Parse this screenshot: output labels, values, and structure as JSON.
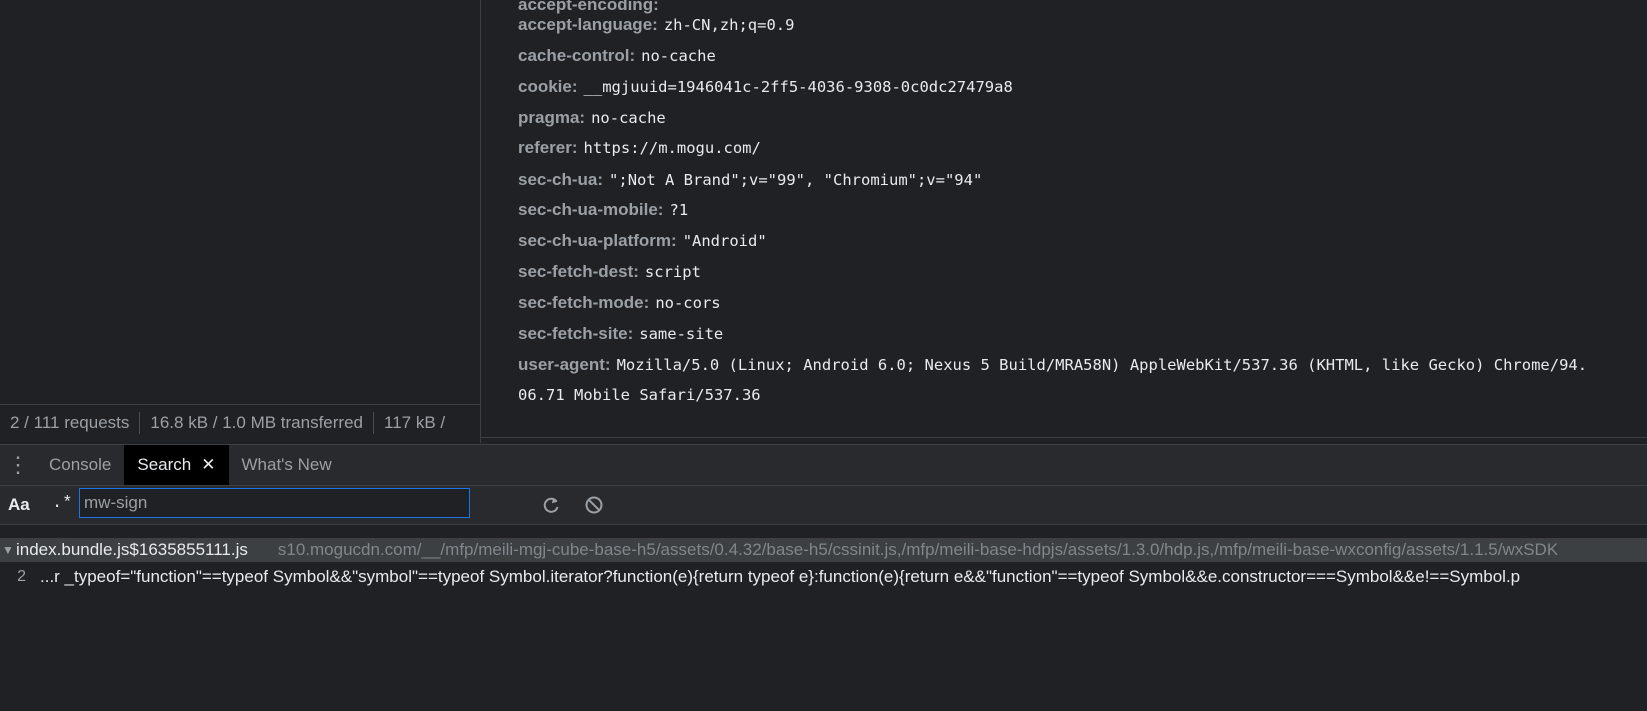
{
  "headers": {
    "rows": [
      {
        "name": "accept-language:",
        "value": "zh-CN,zh;q=0.9"
      },
      {
        "name": "cache-control:",
        "value": "no-cache"
      },
      {
        "name": "cookie:",
        "value": "__mgjuuid=1946041c-2ff5-4036-9308-0c0dc27479a8"
      },
      {
        "name": "pragma:",
        "value": "no-cache"
      },
      {
        "name": "referer:",
        "value": "https://m.mogu.com/"
      },
      {
        "name": "sec-ch-ua:",
        "value": "\";Not A Brand\";v=\"99\", \"Chromium\";v=\"94\""
      },
      {
        "name": "sec-ch-ua-mobile:",
        "value": "?1"
      },
      {
        "name": "sec-ch-ua-platform:",
        "value": "\"Android\""
      },
      {
        "name": "sec-fetch-dest:",
        "value": "script"
      },
      {
        "name": "sec-fetch-mode:",
        "value": "no-cors"
      },
      {
        "name": "sec-fetch-site:",
        "value": "same-site"
      },
      {
        "name": "user-agent:",
        "value": "Mozilla/5.0 (Linux; Android 6.0; Nexus 5 Build/MRA58N) AppleWebKit/537.36 (KHTML, like Gecko) Chrome/94."
      }
    ],
    "user_agent_continued": "06.71 Mobile Safari/537.36"
  },
  "status_bar": {
    "requests": "2 / 111 requests",
    "transferred": "16.8 kB / 1.0 MB transferred",
    "resources": "117 kB /"
  },
  "drawer": {
    "tabs": [
      {
        "label": "Console"
      },
      {
        "label": "Search"
      },
      {
        "label": "What's New"
      }
    ],
    "close_glyph": "✕"
  },
  "search": {
    "match_case_label": "Aa",
    "regex_label": ".*",
    "query": "mw-sign"
  },
  "results": {
    "file_name": "index.bundle.js$1635855111.js",
    "file_path": "s10.mogucdn.com/__/mfp/meili-mgj-cube-base-h5/assets/0.4.32/base-h5/cssinit.js,/mfp/meili-base-hdpjs/assets/1.3.0/hdp.js,/mfp/meili-base-wxconfig/assets/1.1.5/wxSDK",
    "line_number": "2",
    "line_text": "...r _typeof=\"function\"==typeof Symbol&&\"symbol\"==typeof Symbol.iterator?function(e){return typeof e}:function(e){return e&&\"function\"==typeof Symbol&&e.constructor===Symbol&&e!==Symbol.p"
  }
}
